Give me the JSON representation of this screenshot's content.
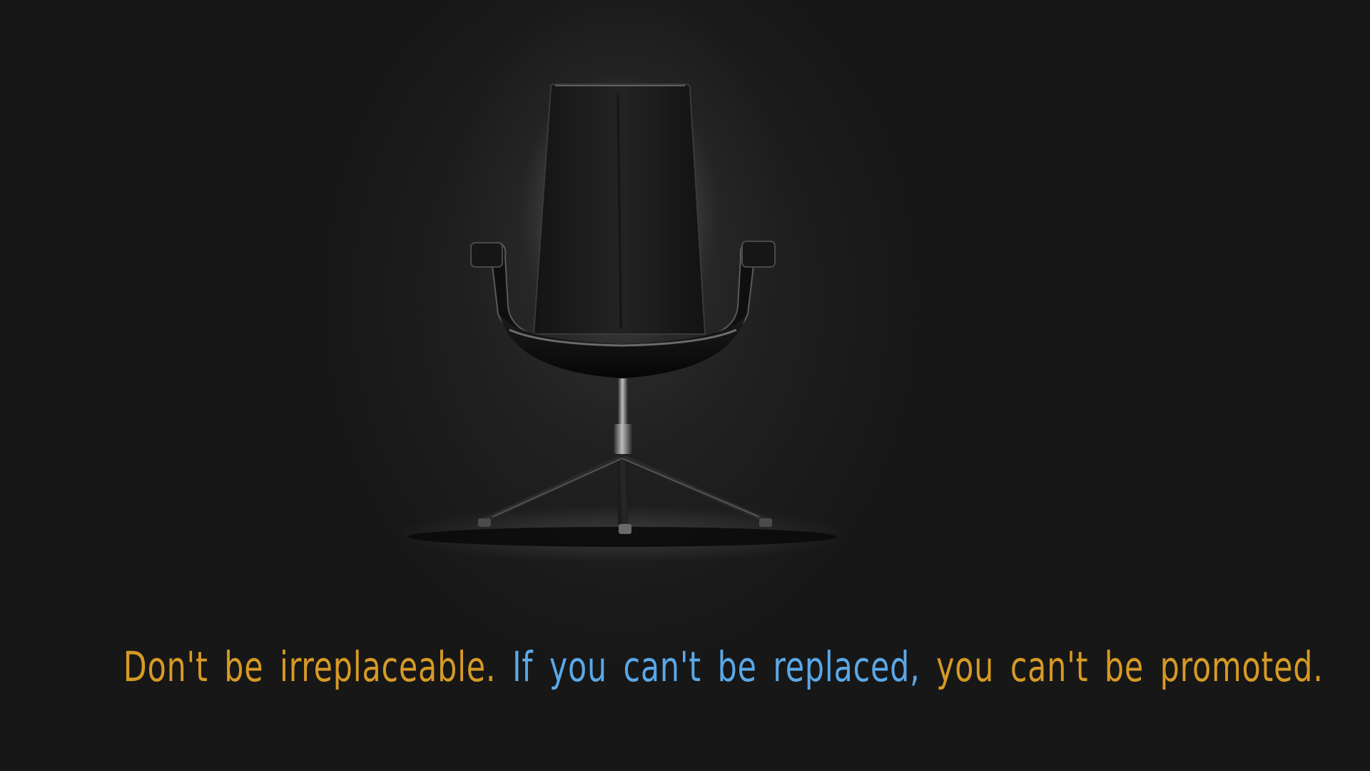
{
  "quote": {
    "part1": "Don't be irreplaceable.",
    "part2": "If you can't be replaced,",
    "part3": "you can't be promoted."
  },
  "colors": {
    "background": "#171717",
    "accent_orange": "#d69a25",
    "accent_blue": "#5aa8e8"
  }
}
